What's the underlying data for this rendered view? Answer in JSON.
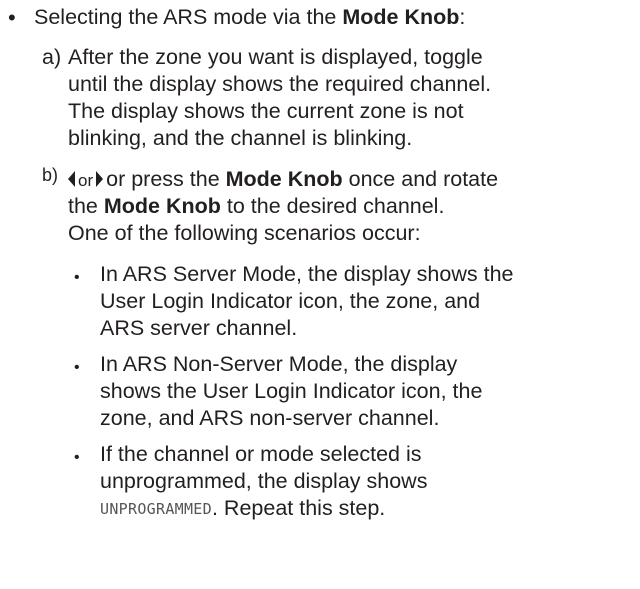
{
  "bullet_item": {
    "marker": "•",
    "text_prefix": "Selecting the ARS mode via the ",
    "mode_knob": "Mode Knob",
    "text_suffix": ":"
  },
  "step_a": {
    "marker": "a)",
    "lines": [
      "After the zone you want is displayed, toggle",
      "until the display shows the required channel.",
      "The display shows the current zone is not",
      "blinking, and the channel is blinking."
    ]
  },
  "step_b": {
    "marker": "b)",
    "line1_or1": "or",
    "line1_or2": "or press the ",
    "mode_knob": "Mode Knob",
    "line1_end": " once and rotate",
    "line2_start": "the ",
    "line2_end": " to the desired channel.",
    "line3": "One of the following scenarios occur:",
    "left_arrow_icon": "left-arrow-key-icon",
    "right_arrow_icon": "right-arrow-key-icon"
  },
  "scenarios": {
    "marker": "•",
    "server": [
      "In ARS Server Mode, the display shows the",
      "User Login Indicator icon, the zone, and",
      "ARS server channel."
    ],
    "non_server": [
      "In ARS Non-Server Mode, the display",
      "shows the User Login Indicator icon, the",
      "zone, and ARS non-server channel."
    ],
    "unprogrammed": {
      "line1": "If the channel or mode selected is",
      "line2": "unprogrammed, the display shows",
      "lcd_text": "UNPROGRAMMED",
      "line3_end": ". Repeat this step."
    }
  }
}
